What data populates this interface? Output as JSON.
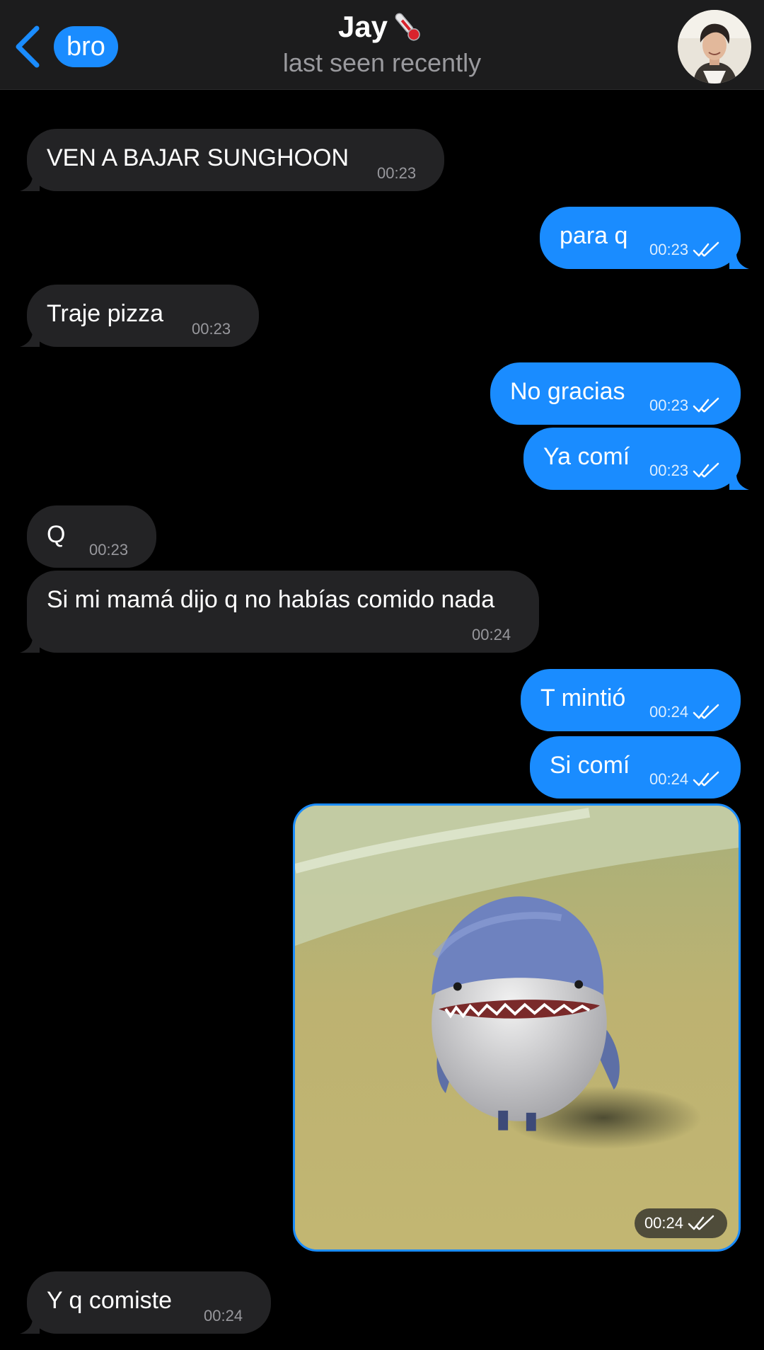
{
  "header": {
    "back_label": "bro",
    "title": "Jay",
    "title_emoji": "🌡️",
    "status": "last seen recently"
  },
  "colors": {
    "accent": "#1a8cff",
    "incoming_bubble": "#232325",
    "background": "#000000"
  },
  "messages": [
    {
      "side": "in",
      "text": "VEN A BAJAR SUNGHOON",
      "time": "00:23"
    },
    {
      "side": "out",
      "text": "para q",
      "time": "00:23",
      "read": true
    },
    {
      "side": "in",
      "text": "Traje pizza",
      "time": "00:23"
    },
    {
      "side": "out",
      "text": "No gracias",
      "time": "00:23",
      "read": true
    },
    {
      "side": "out",
      "text": "Ya comí",
      "time": "00:23",
      "read": true
    },
    {
      "side": "in",
      "text": "Q",
      "time": "00:23"
    },
    {
      "side": "in",
      "text": "Si mi mamá dijo q no habías comido nada",
      "time": "00:24"
    },
    {
      "side": "out",
      "text": "T mintió",
      "time": "00:24",
      "read": true
    },
    {
      "side": "out",
      "text": "Si comí",
      "time": "00:24",
      "read": true
    },
    {
      "side": "out",
      "type": "image",
      "image": "shark-photo",
      "time": "00:24",
      "read": true
    },
    {
      "side": "in",
      "text": "Y q comiste",
      "time": "00:24"
    }
  ]
}
